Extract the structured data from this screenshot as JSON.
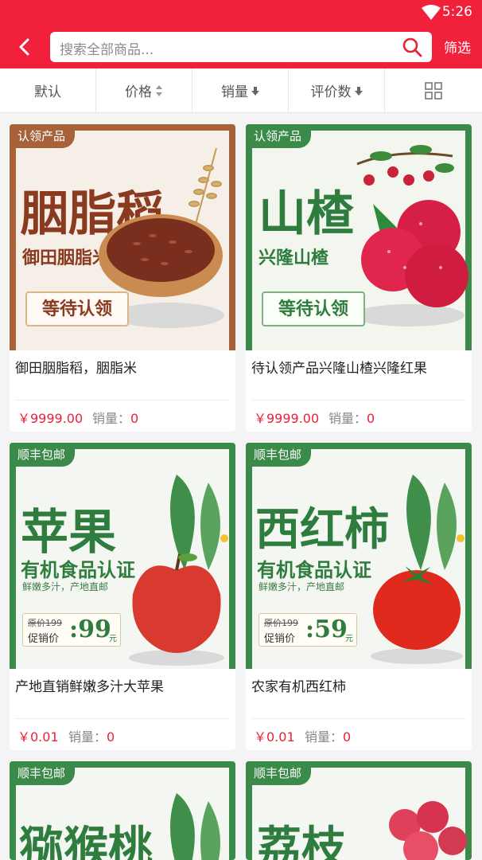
{
  "status": {
    "time": "5:26"
  },
  "header": {
    "search_placeholder": "搜索全部商品...",
    "filter_label": "筛选"
  },
  "sort": {
    "default": "默认",
    "price": "价格",
    "sales": "销量",
    "rating": "评价数"
  },
  "products": [
    {
      "tag": "认领产品",
      "title": "胭脂稻",
      "subtitle": "御田胭脂米",
      "badge": "等待认领",
      "name": "御田胭脂稻，胭脂米",
      "price": "￥9999.00",
      "sales_label": "销量：",
      "sales": "0",
      "colors": {
        "frame": "#a8623a",
        "bg": "#f5efe8",
        "title": "#8a3b1f"
      }
    },
    {
      "tag": "认领产品",
      "title": "山楂",
      "subtitle": "兴隆山楂",
      "badge": "等待认领",
      "name": "待认领产品兴隆山楂兴隆红果",
      "price": "￥9999.00",
      "sales_label": "销量：",
      "sales": "0",
      "colors": {
        "frame": "#3b8a4a",
        "bg": "#f2f6ef",
        "title": "#2f7d3e"
      }
    },
    {
      "tag": "顺丰包邮",
      "title": "苹果",
      "subtitle": "有机食品认证",
      "note": "鲜嫩多汁，产地直邮",
      "orig": "原价199",
      "promo_label": "促销价",
      "promo_price": ":99",
      "promo_unit": "元",
      "name": "产地直销鲜嫩多汁大苹果",
      "price": "￥0.01",
      "sales_label": "销量：",
      "sales": "0",
      "colors": {
        "frame": "#3b8a4a",
        "bg": "#f4f7f1",
        "title": "#2f7d3e"
      }
    },
    {
      "tag": "顺丰包邮",
      "title": "西红柿",
      "subtitle": "有机食品认证",
      "note": "鲜嫩多汁，产地直邮",
      "orig": "原价199",
      "promo_label": "促销价",
      "promo_price": ":59",
      "promo_unit": "元",
      "name": "农家有机西红柿",
      "price": "￥0.01",
      "sales_label": "销量：",
      "sales": "0",
      "colors": {
        "frame": "#3b8a4a",
        "bg": "#f4f7f1",
        "title": "#2f7d3e"
      }
    },
    {
      "tag": "顺丰包邮",
      "title": "猕猴桃",
      "colors": {
        "frame": "#3b8a4a",
        "bg": "#f4f7f1",
        "title": "#2f7d3e"
      }
    },
    {
      "tag": "顺丰包邮",
      "title": "荔枝",
      "colors": {
        "frame": "#3b8a4a",
        "bg": "#f4f7f1",
        "title": "#2f7d3e"
      }
    }
  ],
  "icons": {
    "wifi": "wifi-icon",
    "back": "back-arrow-icon",
    "search": "search-icon",
    "sort": "sort-arrows-icon",
    "grid": "grid-view-icon"
  },
  "theme": {
    "brand": "#f2213b",
    "price": "#e8213b"
  }
}
